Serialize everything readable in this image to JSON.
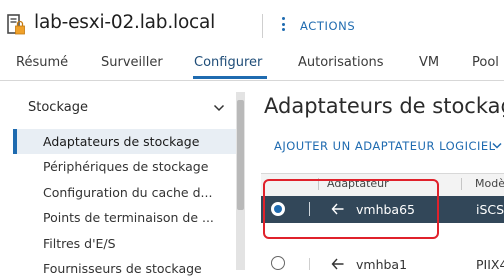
{
  "header": {
    "host_icon": "host-lock-icon",
    "title": "lab-esxi-02.lab.local",
    "actions_label": "ACTIONS"
  },
  "tabs": [
    {
      "label": "Résumé"
    },
    {
      "label": "Surveiller"
    },
    {
      "label": "Configurer",
      "active": true
    },
    {
      "label": "Autorisations"
    },
    {
      "label": "VM"
    },
    {
      "label": "Pool"
    }
  ],
  "sidebar": {
    "group_label": "Stockage",
    "items": [
      {
        "label": "Adaptateurs de stockage",
        "active": true
      },
      {
        "label": "Périphériques de stockage"
      },
      {
        "label": "Configuration du cache d..."
      },
      {
        "label": "Points de terminaison de ..."
      },
      {
        "label": "Filtres d'E/S"
      },
      {
        "label": "Fournisseurs de stockage"
      }
    ]
  },
  "main": {
    "title": "Adaptateurs de stockage",
    "add_button_label": "AJOUTER UN ADAPTATEUR LOGICIEL",
    "table": {
      "columns": [
        "Adaptateur",
        "Modè"
      ],
      "rows": [
        {
          "name": "vmhba65",
          "model": "iSCS",
          "selected": true
        },
        {
          "name": "vmhba1",
          "model": "PIIX4",
          "selected": false
        }
      ]
    }
  },
  "colors": {
    "accent": "#1f6bb0",
    "selected_row": "#324759",
    "highlight_box": "#e0212b"
  }
}
